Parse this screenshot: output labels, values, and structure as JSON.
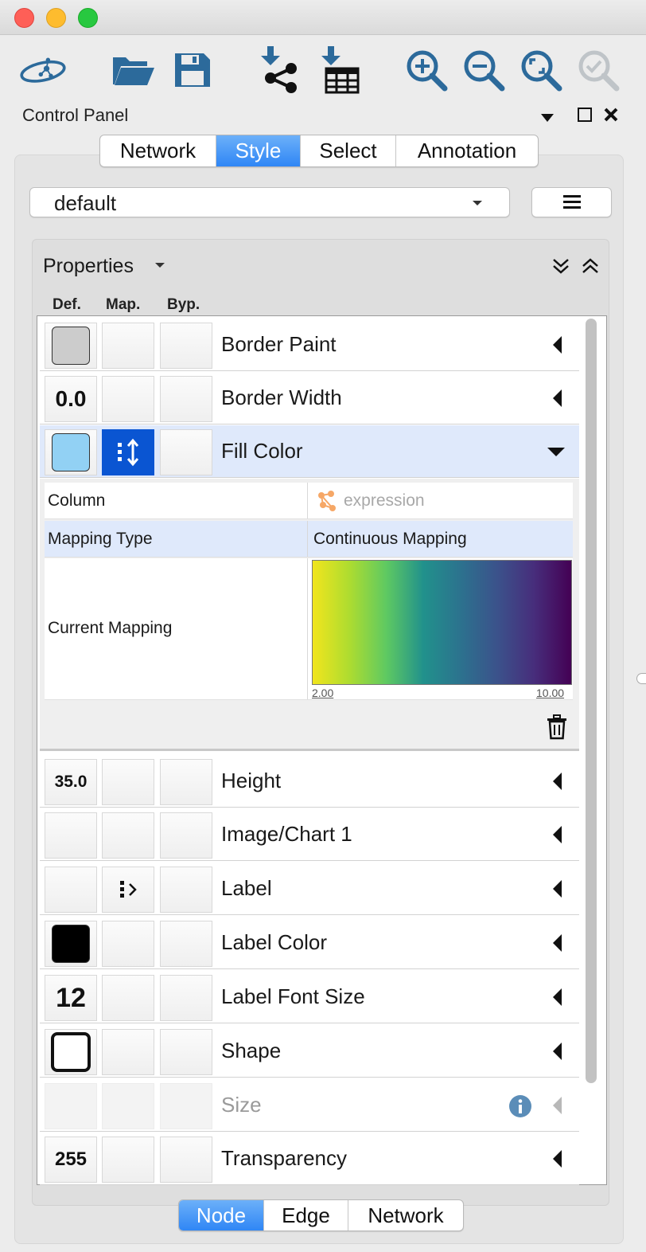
{
  "window": {
    "title": ""
  },
  "toolbar": {
    "buttons": [
      {
        "id": "logo",
        "icon": "cytoscape-logo-icon"
      },
      {
        "id": "open",
        "icon": "folder-open-icon"
      },
      {
        "id": "save",
        "icon": "save-disk-icon"
      },
      {
        "id": "import-network",
        "icon": "import-network-icon"
      },
      {
        "id": "import-table",
        "icon": "import-table-icon"
      },
      {
        "id": "zoom-in",
        "icon": "zoom-in-icon"
      },
      {
        "id": "zoom-out",
        "icon": "zoom-out-icon"
      },
      {
        "id": "zoom-fit",
        "icon": "zoom-fit-icon"
      },
      {
        "id": "zoom-selected",
        "icon": "zoom-selected-icon"
      }
    ]
  },
  "control_panel": {
    "title": "Control Panel",
    "tabs": [
      "Network",
      "Style",
      "Select",
      "Annotation"
    ],
    "active_tab": "Style",
    "style_select": "default",
    "properties_label": "Properties",
    "columns": {
      "def": "Def.",
      "map": "Map.",
      "byp": "Byp."
    },
    "rows": [
      {
        "label": "Border Paint",
        "def": "swatch-gray"
      },
      {
        "label": "Border Width",
        "def": "0.0"
      },
      {
        "label": "Fill Color",
        "def": "swatch-lightblue",
        "expanded": true
      },
      {
        "label": "Height",
        "def": "35.0"
      },
      {
        "label": "Image/Chart 1",
        "def": ""
      },
      {
        "label": "Label",
        "def": ""
      },
      {
        "label": "Label Color",
        "def": "swatch-black"
      },
      {
        "label": "Label Font Size",
        "def": "12"
      },
      {
        "label": "Shape",
        "def": "shape-roundrect"
      },
      {
        "label": "Size",
        "def": "",
        "disabled": true
      },
      {
        "label": "Transparency",
        "def": "255"
      }
    ],
    "fill_detail": {
      "column_key": "Column",
      "column_value": "expression",
      "mapping_type_key": "Mapping Type",
      "mapping_type_value": "Continuous Mapping",
      "current_mapping_key": "Current Mapping",
      "range_min": "2.00",
      "range_max": "10.00"
    },
    "bottom_tabs": [
      "Node",
      "Edge",
      "Network"
    ],
    "active_bottom_tab": "Node"
  },
  "colors": {
    "accent": "#2f86f5",
    "fill_swatch": "#92d1f4",
    "border_swatch": "#cccccc",
    "label_swatch": "#000000",
    "icon_blue": "#2c6a9b"
  }
}
